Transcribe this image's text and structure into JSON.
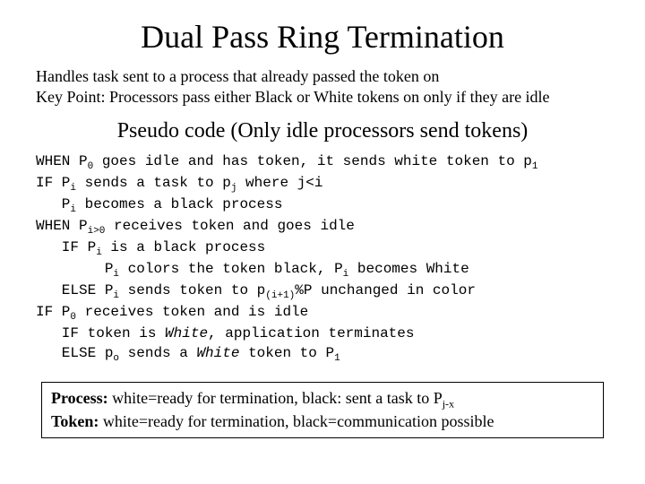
{
  "title": "Dual Pass Ring Termination",
  "intro": {
    "line1": "Handles task sent to a process that already passed the token on",
    "line2": "Key Point: Processors pass either Black or White tokens on only if they are idle"
  },
  "subtitle": "Pseudo code (Only idle processors send tokens)",
  "pseudo": {
    "l1a": "WHEN P",
    "l1sub": "0",
    "l1b": " goes idle and has token, it sends white token to p",
    "l1sub2": "1",
    "l2a": "IF P",
    "l2sub": "i",
    "l2b": " sends a task to p",
    "l2sub2": "j",
    "l2c": " where j<i",
    "l3a": "   P",
    "l3sub": "i",
    "l3b": " becomes a black process",
    "l4a": "WHEN P",
    "l4sub": "i>0",
    "l4b": " receives token and goes idle",
    "l5a": "   IF P",
    "l5sub": "i",
    "l5b": " is a black process",
    "l6a": "        P",
    "l6sub": "i",
    "l6b": " colors the token black, P",
    "l6sub2": "i",
    "l6c": " becomes White",
    "l7a": "   ELSE P",
    "l7sub": "i",
    "l7b": " sends token to p",
    "l7sub2": "(i+1)",
    "l7c": "%P unchanged in color",
    "l8a": "IF P",
    "l8sub": "0",
    "l8b": " receives token and is idle",
    "l9a": "   IF token is ",
    "l9it": "White",
    "l9b": ", application terminates",
    "l10a": "   ELSE p",
    "l10sub": "o",
    "l10b": " sends a ",
    "l10it": "White",
    "l10c": " token to P",
    "l10sub2": "1"
  },
  "legend": {
    "p_label": "Process:",
    "p_text": " white=ready for termination, black: sent a task to P",
    "p_sub": "j-x",
    "t_label": "Token:",
    "t_text": " white=ready for termination, black=communication possible"
  }
}
